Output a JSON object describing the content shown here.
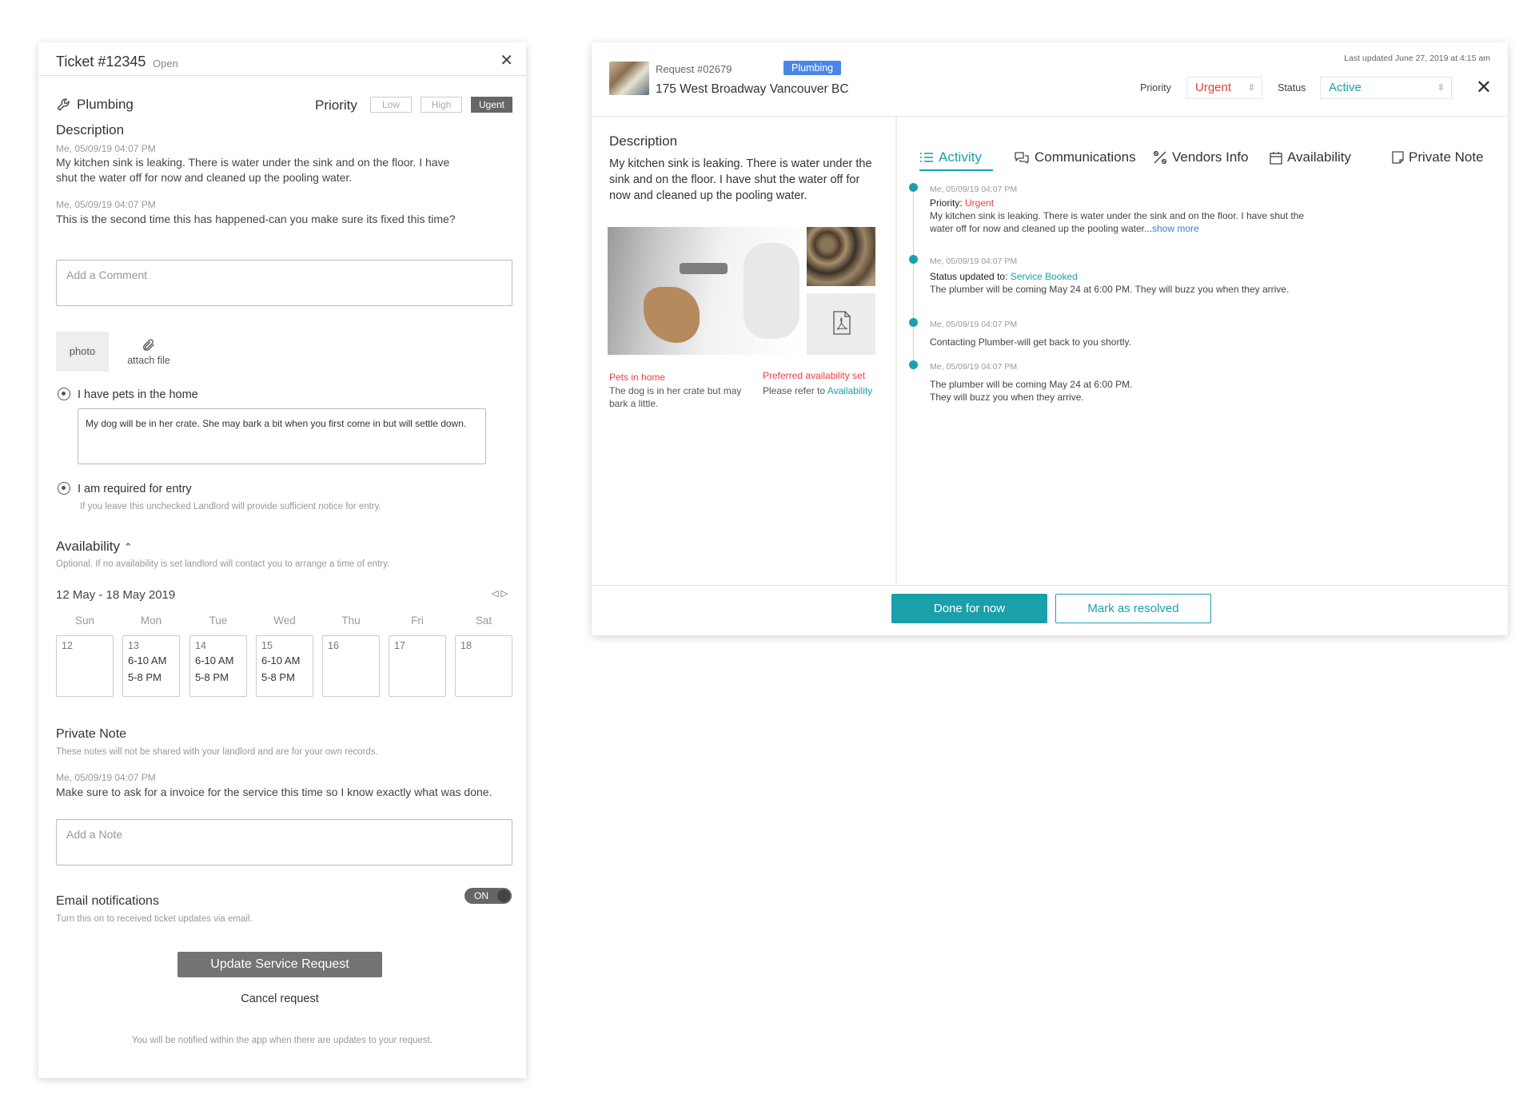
{
  "ticket": {
    "title": "Ticket #12345",
    "status": "Open",
    "category": "Plumbing",
    "priority_label": "Priority",
    "priority_options": [
      "Low",
      "High",
      "Ugent"
    ],
    "selected_priority": "Ugent",
    "description_title": "Description",
    "messages": [
      {
        "meta": "Me, 05/09/19 04:07 PM",
        "text_line1": "My kitchen sink is leaking.  There is water under the sink and on the floor.  I have",
        "text_line2": "shut the water off for now and cleaned up the pooling water."
      },
      {
        "meta": "Me, 05/09/19 04:07 PM",
        "text_line1": "This is the second time this has happened-can you make sure its fixed this time?"
      }
    ],
    "comment_placeholder": "Add a Comment",
    "photo_label": "photo",
    "attach_label": "attach file",
    "pets_label": "I have pets in the home",
    "pets_note": "My dog will be in her crate.  She may bark a bit when you first come in but will settle down.",
    "entry_label": "I am required for entry",
    "entry_hint": "If you leave this unchecked Landlord will provide sufficient notice for entry.",
    "availability_title": "Availability",
    "availability_hint": "Optional.  If no availability is set landlord will contact you to arrange a time of entry.",
    "calendar": {
      "range": "12 May - 18 May 2019",
      "days": [
        {
          "name": "Sun",
          "date": "12",
          "slots": []
        },
        {
          "name": "Mon",
          "date": "13",
          "slots": [
            "6-10 AM",
            "5-8 PM"
          ]
        },
        {
          "name": "Tue",
          "date": "14",
          "slots": [
            "6-10 AM",
            "5-8 PM"
          ]
        },
        {
          "name": "Wed",
          "date": "15",
          "slots": [
            "6-10 AM",
            "5-8 PM"
          ]
        },
        {
          "name": "Thu",
          "date": "16",
          "slots": []
        },
        {
          "name": "Fri",
          "date": "17",
          "slots": []
        },
        {
          "name": "Sat",
          "date": "18",
          "slots": []
        }
      ]
    },
    "private_note_title": "Private Note",
    "private_note_hint": "These notes will not be shared with your landlord and are for your own records.",
    "private_note_meta": "Me, 05/09/19 04:07 PM",
    "private_note_text": "Make sure to ask for a invoice for the service this time so I know exactly what was done.",
    "note_placeholder": "Add a Note",
    "email_title": "Email notifications",
    "email_hint": "Turn this on to received ticket updates via email.",
    "email_toggle": "ON",
    "update_button": "Update Service Request",
    "cancel_link": "Cancel request",
    "footnote": "You will be notified within the app when there are updates to your request."
  },
  "request": {
    "number": "Request #02679",
    "tag": "Plumbing",
    "address": "175 West Broadway Vancouver BC",
    "last_updated": "Last updated June 27, 2019 at 4:15 am",
    "priority_label": "Priority",
    "priority_value": "Urgent",
    "status_label": "Status",
    "status_value": "Active",
    "description_title": "Description",
    "description": "My kitchen sink is leaking. There is water under the sink and on the floor.  I have shut the water off for now and cleaned up the pooling water.",
    "pets_title": "Pets in home",
    "pets_text": "The dog is in her crate but may bark a little.",
    "avail_title": "Preferred availability set",
    "avail_text": "Please refer to",
    "avail_link": "Availability",
    "tabs": [
      "Activity",
      "Communications",
      "Vendors Info",
      "Availability",
      "Private Note"
    ],
    "activity": [
      {
        "meta": "Me, 05/09/19 04:07 PM",
        "label": "Priority:",
        "value": "Urgent",
        "line1": "My kitchen sink is leaking.  There is water under the sink and on the floor.  I have shut the",
        "line2": "water off for now and cleaned up the pooling water...",
        "more": "show more"
      },
      {
        "meta": "Me, 05/09/19 04:07 PM",
        "label": "Status updated to:",
        "value": "Service Booked",
        "line1": "The plumber will be coming May 24 at 6:00 PM. They will buzz you when they arrive."
      },
      {
        "meta": "Me, 05/09/19 04:07 PM",
        "line1": "Contacting Plumber-will get back to you shortly."
      },
      {
        "meta": "Me, 05/09/19 04:07 PM",
        "line1": "The plumber will be coming May 24 at 6:00 PM.",
        "line2": "They will buzz you when they arrive."
      }
    ],
    "done_button": "Done for now",
    "resolve_button": "Mark as resolved"
  },
  "colors": {
    "teal": "#1aa0aa",
    "red": "#e53e3e",
    "blue": "#4a86e8"
  }
}
